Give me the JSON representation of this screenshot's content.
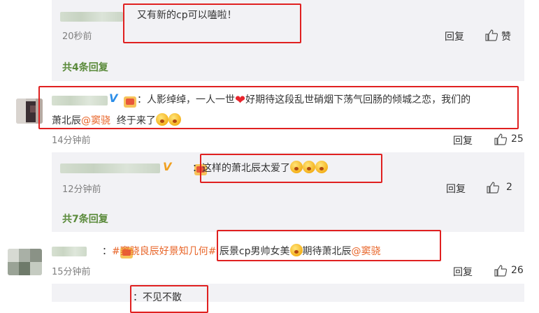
{
  "comment0": {
    "reply_text": "又有新的cp可以嗑啦！",
    "time": "20秒前",
    "reply_label": "回复",
    "like_label": "赞",
    "more_replies": "共4条回复"
  },
  "comment1": {
    "colon": "：",
    "text_a": "人影绰绰，一人一世",
    "text_b": "好期待这段乱世硝烟下荡气回肠的倾城之恋，我们的",
    "text_c": "萧北辰",
    "mention": "@窦骁",
    "text_d": "终于来了",
    "time": "14分钟前",
    "reply_label": "回复",
    "like_count": "25"
  },
  "reply1": {
    "colon": "：",
    "text": "这样的萧北辰太爱了",
    "time": "12分钟前",
    "reply_label": "回复",
    "like_count": "2",
    "more_replies": "共7条回复"
  },
  "comment2": {
    "colon": "：",
    "topic": "#窦骁良辰好景知几何#",
    "text_a": "辰景cp男帅女美",
    "text_b": "期待萧北辰",
    "mention": "@窦骁",
    "time": "15分钟前",
    "reply_label": "回复",
    "like_count": "26"
  },
  "reply2": {
    "text": "：不见不散"
  },
  "icons": {
    "thumb": "thumbs-up-icon",
    "verified": "verified-v-icon",
    "vip": "vip-badge-icon",
    "heart": "heart-emoji-icon",
    "emoji": "emoji-face-icon"
  },
  "colors": {
    "highlight_box": "#e02020",
    "link": "#e8662a",
    "more_replies": "#5a8a3a",
    "verified_v": "#2c8ee8",
    "reply_background": "#f2f2f5"
  }
}
